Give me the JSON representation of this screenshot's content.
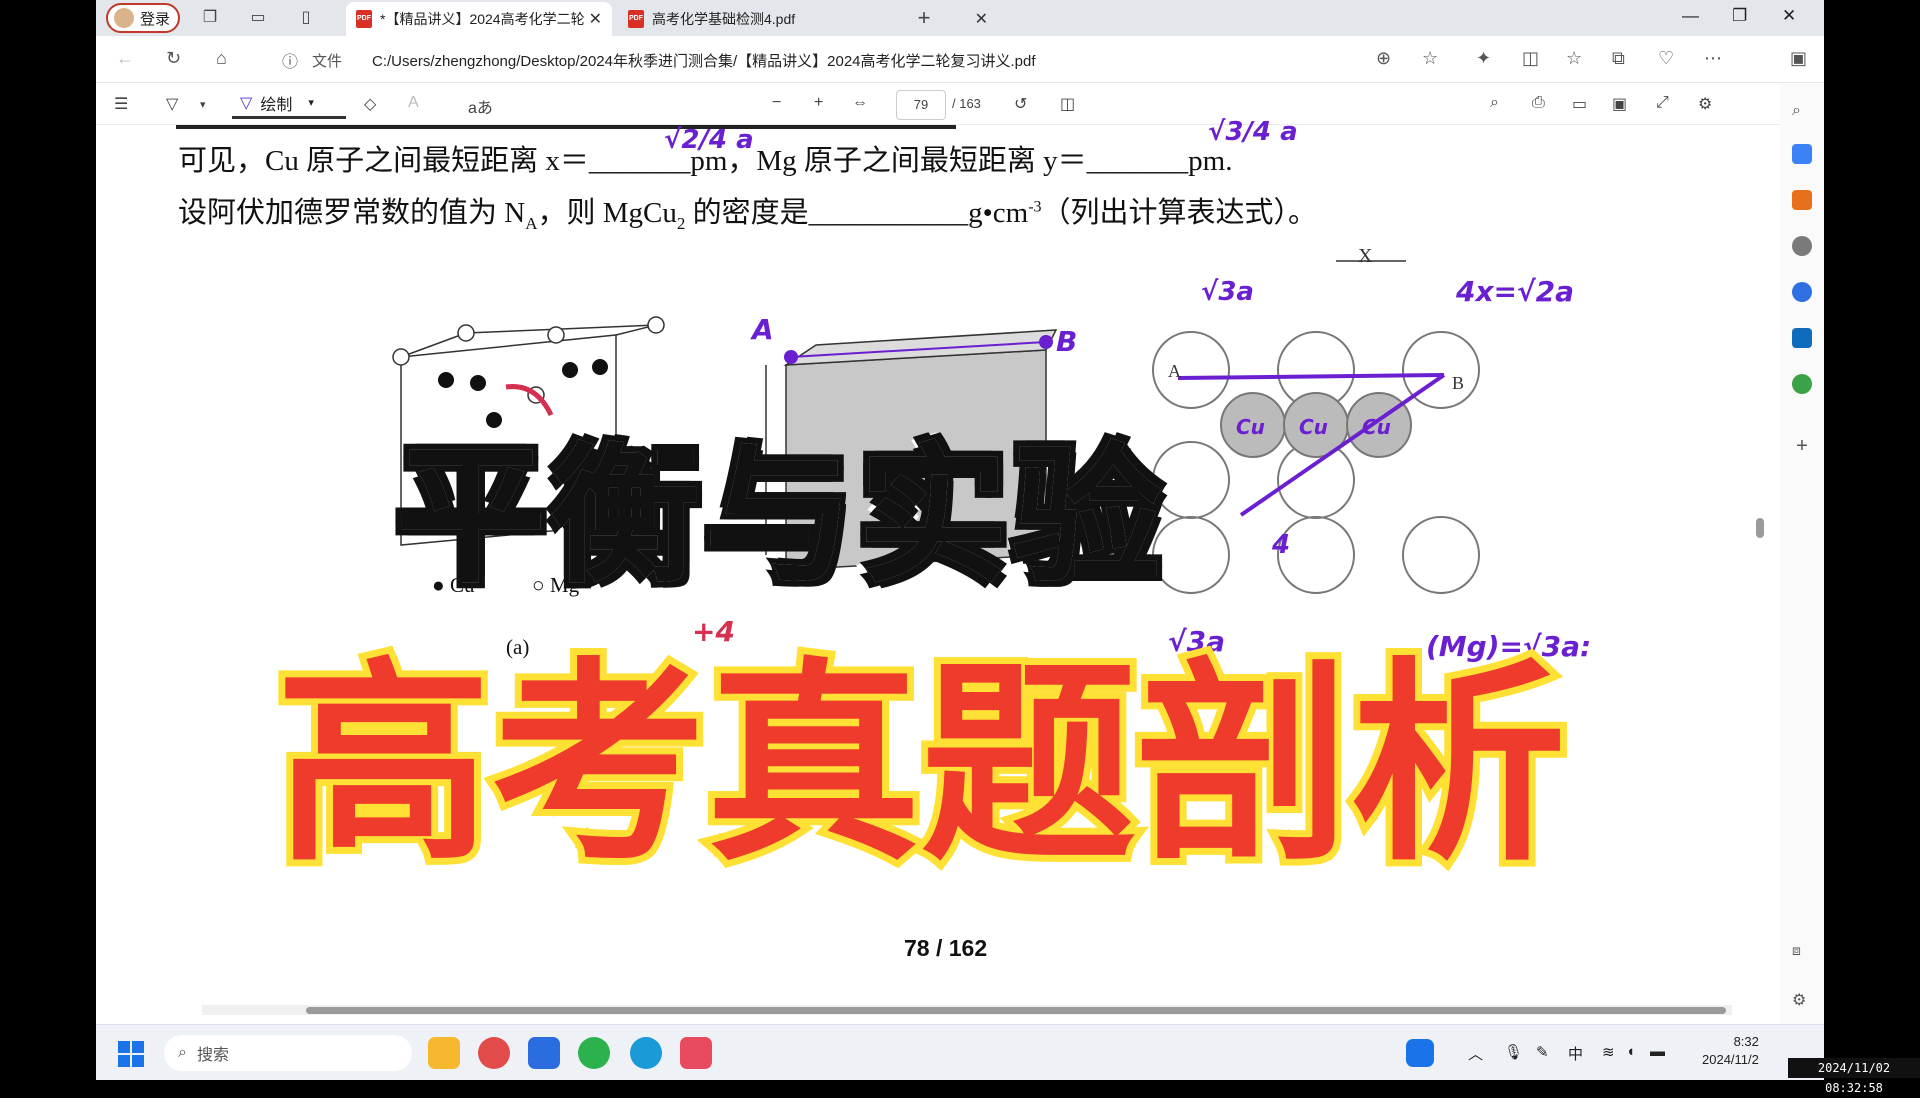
{
  "browser": {
    "login_label": "登录",
    "tabs": [
      {
        "label": "*【精品讲义】2024高考化学二轮",
        "active": true
      },
      {
        "label": "高考化学基础检测4.pdf",
        "active": false
      }
    ],
    "new_tab": "+",
    "file_label": "文件",
    "url": "C:/Users/zhengzhong/Desktop/2024年秋季进门测合集/【精品讲义】2024高考化学二轮复习讲义.pdf"
  },
  "pdf_toolbar": {
    "draw_label": "绘制",
    "text_tool": "aあ",
    "current_page": "79",
    "total_pages": "/ 163"
  },
  "document": {
    "line1": "可见，Cu 原子之间最短距离 x＝_______pm，Mg 原子之间最短距离 y＝_______pm.",
    "line2": "设阿伏加德罗常数的值为 N",
    "line2_sub": "A",
    "line2_rest": "，则 MgCu",
    "line2_sub2": "2",
    "line2_end": " 的密度是___________g•cm",
    "line2_sup": "-3",
    "line2_tail": "（列出计算表达式）。",
    "legend_cu": "Cu",
    "legend_mg": "Mg",
    "fig_a": "(a)",
    "page_footer": "78  /  162",
    "handwriting": {
      "x_answer": "√2/4 a",
      "y_answer": "√3/4 a",
      "eq1": "4x=√2a",
      "label_a_top": "A",
      "label_b_top": "B",
      "label_root3a": "√3a",
      "label_x": "X",
      "circle_a": "A",
      "circle_b": "B",
      "cu1": "Cu",
      "cu2": "Cu",
      "cu3": "Cu",
      "quarter": "4",
      "mg_eq": "(Mg)=√3a:",
      "plus4": "+4",
      "root3a": "√3a"
    }
  },
  "overlay": {
    "title_top": "平衡与实验",
    "title_bottom": "高考真题剖析"
  },
  "taskbar": {
    "search_placeholder": "搜索",
    "ime": "中",
    "time": "8:32",
    "date": "2024/11/2"
  },
  "timestamp": "2024/11/02 08:32:58",
  "colors": {
    "ink": "#6a1fd1",
    "title_red": "#ef3b2c",
    "title_yellow": "#ffe135"
  }
}
